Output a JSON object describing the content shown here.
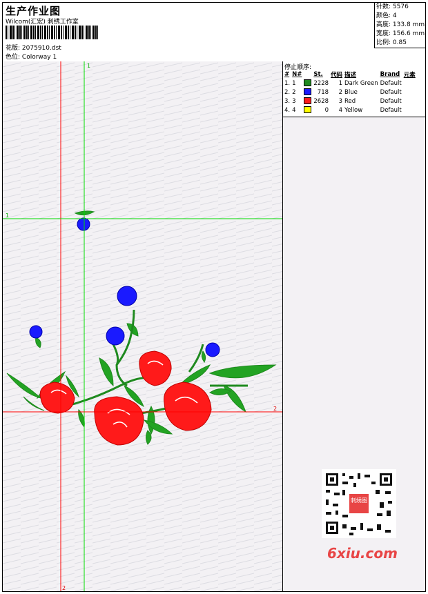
{
  "header": {
    "title": "生产作业图",
    "subtitle": "Wilcom(汇宏) 刺绣工作室",
    "design_label": "花版:",
    "design_file": "2075910.dst",
    "colorway_label": "色位:",
    "colorway": "Colorway 1"
  },
  "stats": [
    {
      "label": "针数:",
      "value": "5576"
    },
    {
      "label": "颜色:",
      "value": "4"
    },
    {
      "label": "高度:",
      "value": "133.8 mm"
    },
    {
      "label": "宽度:",
      "value": "156.6 mm"
    },
    {
      "label": "比例:",
      "value": "0.85"
    }
  ],
  "stop_sequence": {
    "title": "停止顺序:",
    "headers": [
      "#",
      "N#",
      "St.",
      "代码",
      "描述",
      "Brand",
      "元素"
    ],
    "rows": [
      {
        "num": "1.",
        "n": "1",
        "color": "#1f8a1f",
        "st": "2228",
        "code": "1",
        "desc": "Dark Green",
        "brand": "Default"
      },
      {
        "num": "2.",
        "n": "2",
        "color": "#1a1aff",
        "st": "718",
        "code": "2",
        "desc": "Blue",
        "brand": "Default"
      },
      {
        "num": "3.",
        "n": "3",
        "color": "#ff1a1a",
        "st": "2628",
        "code": "3",
        "desc": "Red",
        "brand": "Default"
      },
      {
        "num": "4.",
        "n": "4",
        "color": "#ffff00",
        "st": "0",
        "code": "4",
        "desc": "Yellow",
        "brand": "Default"
      }
    ]
  },
  "guides": {
    "v1": "1",
    "h1": "1",
    "v2": "2",
    "h2": "2"
  },
  "watermark": "6xiu.com",
  "qr_text": "刺绣图"
}
